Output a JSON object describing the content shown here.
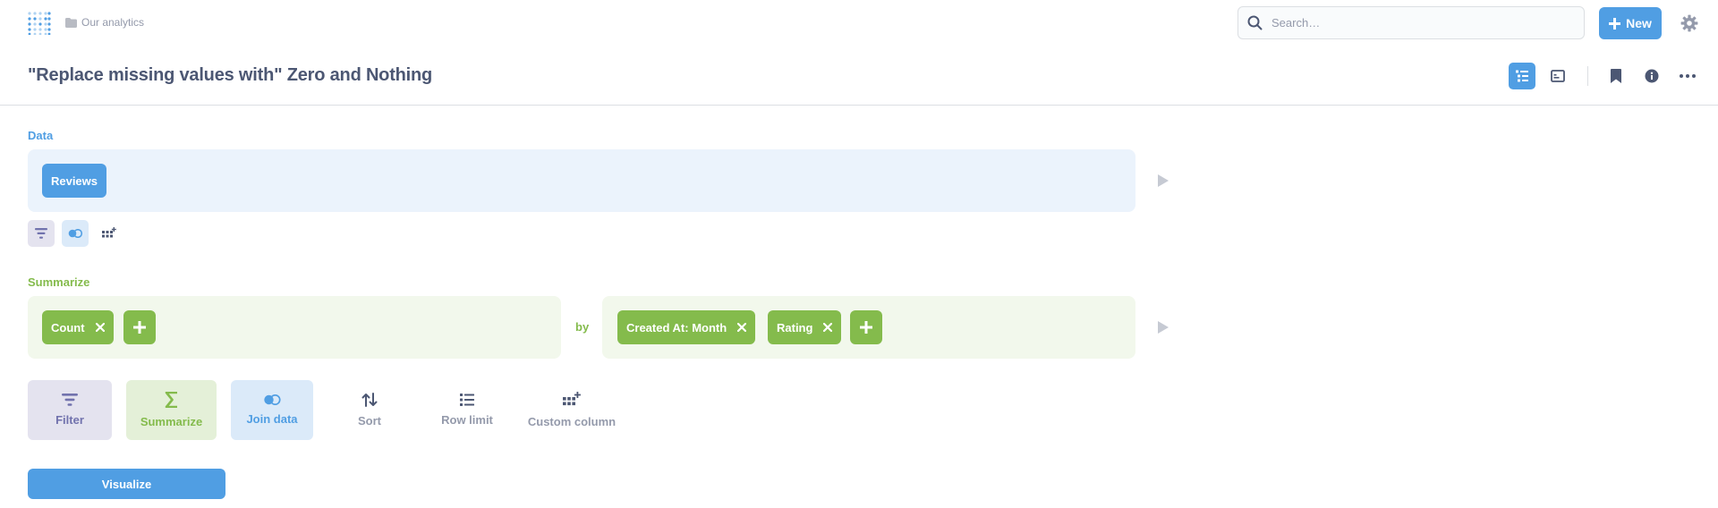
{
  "topbar": {
    "breadcrumb": "Our analytics",
    "search_placeholder": "Search…",
    "new_label": "New"
  },
  "question": {
    "title": "\"Replace missing values with\" Zero and Nothing"
  },
  "data_step": {
    "label": "Data",
    "table": "Reviews"
  },
  "summarize_step": {
    "label": "Summarize",
    "metrics": [
      "Count"
    ],
    "by_label": "by",
    "breakouts": [
      "Created At: Month",
      "Rating"
    ]
  },
  "actions": [
    {
      "label": "Filter",
      "icon": "filter-icon"
    },
    {
      "label": "Summarize",
      "icon": "sigma-icon"
    },
    {
      "label": "Join data",
      "icon": "join-icon"
    },
    {
      "label": "Sort",
      "icon": "sort-icon"
    },
    {
      "label": "Row limit",
      "icon": "list-icon"
    },
    {
      "label": "Custom column",
      "icon": "custom-column-icon"
    }
  ],
  "visualize_label": "Visualize",
  "colors": {
    "brand": "#509ee3",
    "summarize": "#84bb4c",
    "filter": "#7172ad",
    "text": "#4c5773",
    "muted": "#949aab"
  }
}
